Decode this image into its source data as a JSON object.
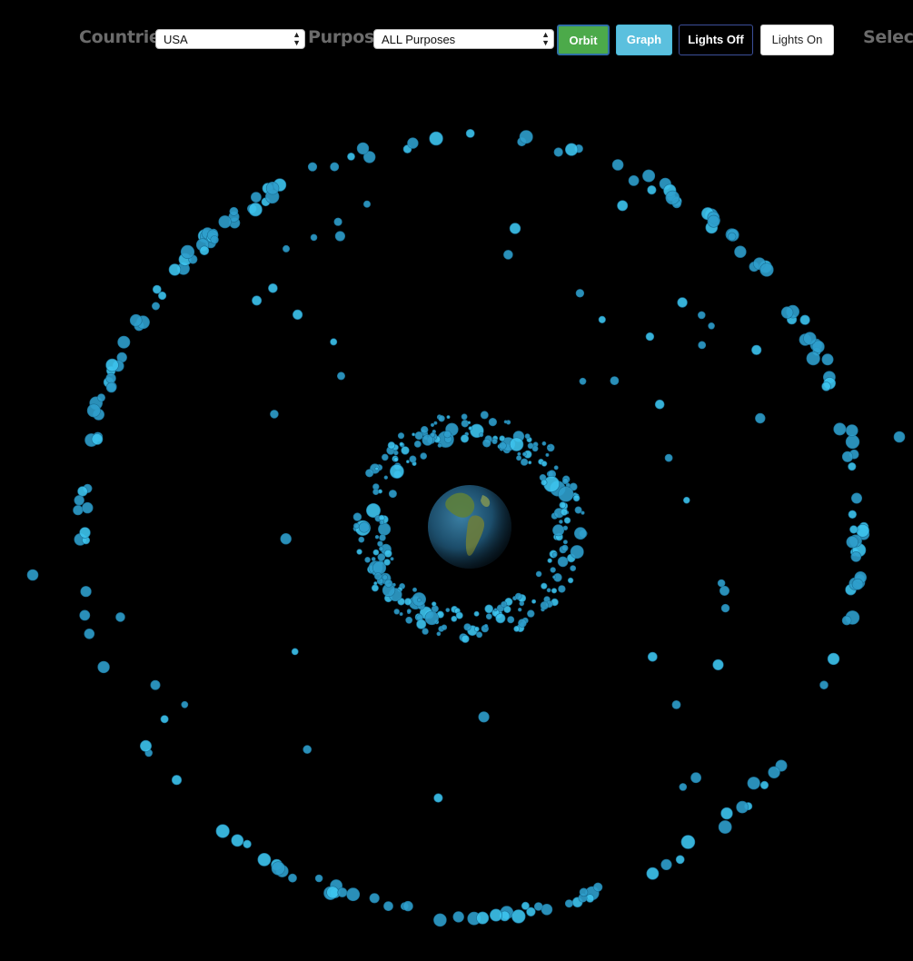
{
  "toolbar": {
    "countries_label": "Countries",
    "countries_value": "USA",
    "purpose_label": "Purpose",
    "purpose_value": "ALL Purposes",
    "orbit_label": "Orbit",
    "graph_label": "Graph",
    "lights_off_label": "Lights Off",
    "lights_on_label": "Lights On",
    "select_label": "Select"
  },
  "colors": {
    "background": "#000000",
    "satellite": "#2f9fcc",
    "satellite_highlight": "#3dc4ee",
    "orbit_active": "#4caa4a",
    "graph_button": "#5bc0de",
    "label": "#6b6b6b"
  },
  "icons": {
    "select_arrows": "updown-arrows-icon",
    "earth": "earth-globe-icon"
  }
}
